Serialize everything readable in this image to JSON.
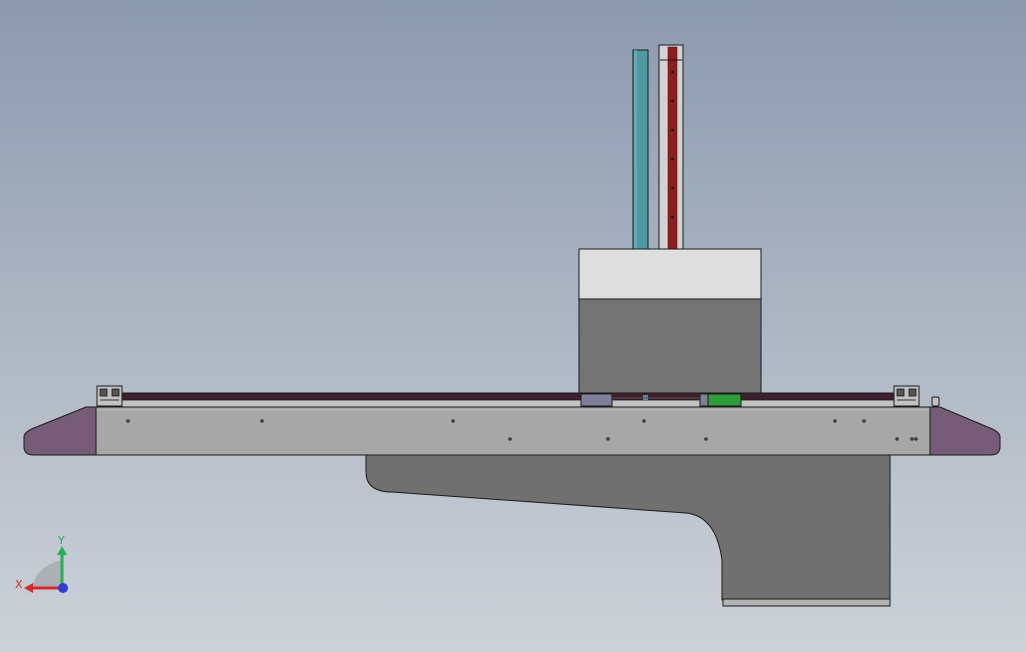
{
  "viewport": {
    "background_top": "#8c9aae",
    "background_bottom": "#cdd2d8"
  },
  "model": {
    "colors": {
      "edge": "#1a1a1a",
      "rail_body": "#a7a7a7",
      "rail_strip": "#c2c2c2",
      "end_cap": "#765c77",
      "top_track": "#3e1f2c",
      "carriage_top": "#dedede",
      "carriage_body": "#747474",
      "mount_bracket": "#707070",
      "mount_foot": "#b4b4b4",
      "teal_rod": "#4e9aa0",
      "red_rail": "#8f1c1e",
      "red_rail_frame": "#d2d2d2",
      "fastener": "#3a3a3a",
      "slider_block": "#7f7f9a",
      "green_part": "#2e9b3c",
      "teal_part": "#4f8f9a"
    }
  },
  "triad": {
    "x_label": "X",
    "y_label": "Y",
    "x_color": "#d22b2b",
    "y_color": "#23b14d",
    "z_color": "#2c3fcf"
  }
}
